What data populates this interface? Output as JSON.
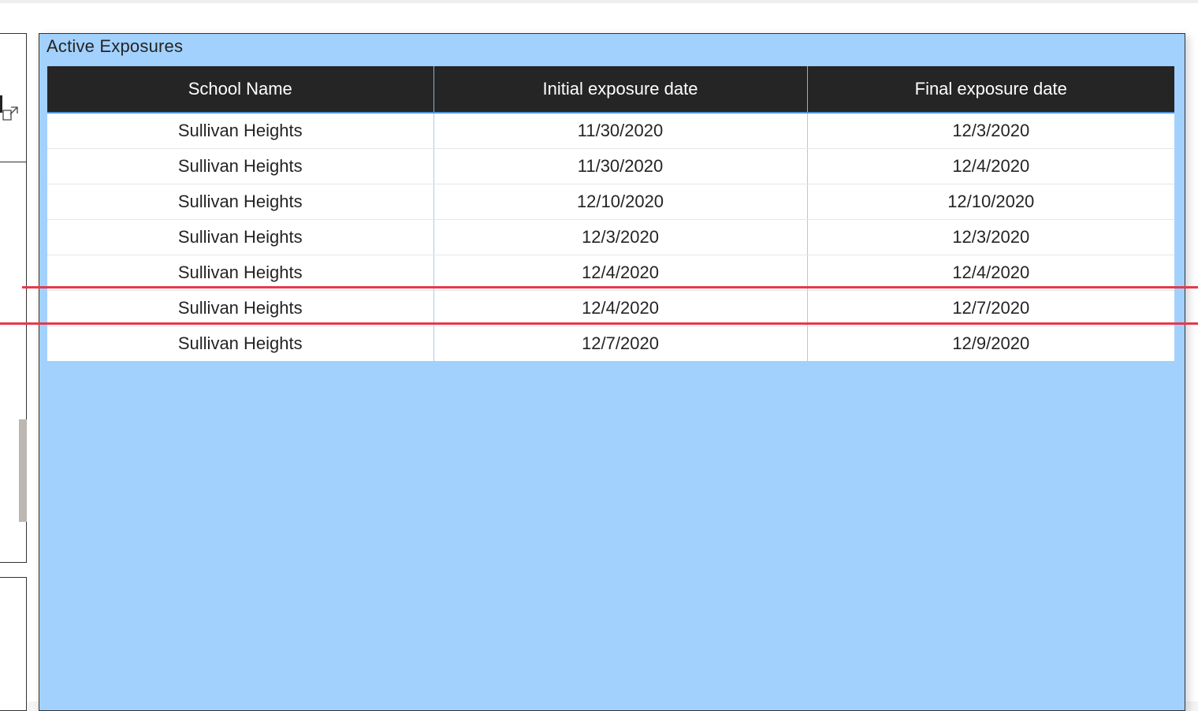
{
  "visual": {
    "title": "Active Exposures",
    "columns": [
      "School Name",
      "Initial exposure date",
      "Final exposure date"
    ],
    "rows": [
      [
        "Sullivan Heights",
        "11/30/2020",
        "12/3/2020"
      ],
      [
        "Sullivan Heights",
        "11/30/2020",
        "12/4/2020"
      ],
      [
        "Sullivan Heights",
        "12/10/2020",
        "12/10/2020"
      ],
      [
        "Sullivan Heights",
        "12/3/2020",
        "12/3/2020"
      ],
      [
        "Sullivan Heights",
        "12/4/2020",
        "12/4/2020"
      ],
      [
        "Sullivan Heights",
        "12/4/2020",
        "12/7/2020"
      ],
      [
        "Sullivan Heights",
        "12/7/2020",
        "12/9/2020"
      ]
    ]
  },
  "colors": {
    "visual_background": "#a2d1fd",
    "header_background": "#252525",
    "highlight_line": "#e53a4b",
    "scrollbar_thumb": "#bdb7b1"
  },
  "icons": {
    "focus_mode": "focus-mode-icon"
  }
}
